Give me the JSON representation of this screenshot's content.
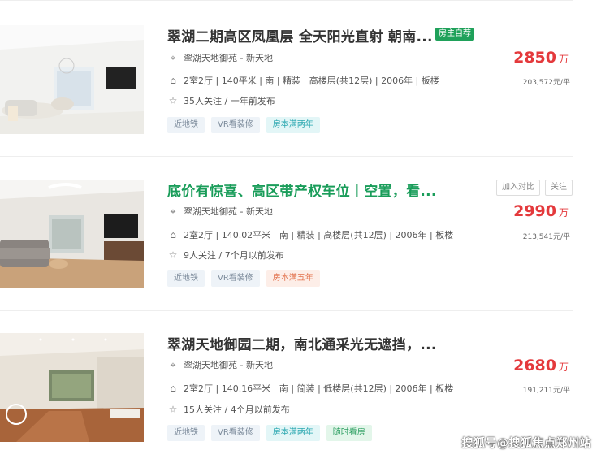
{
  "listings": [
    {
      "title": "翠湖二期高区凤凰层 全天阳光直射 朝南...",
      "badge": "房主自荐",
      "community": "翠湖天地御苑 - 新天地",
      "details": "2室2厅 | 140平米 | 南 | 精装 | 高楼层(共12层) | 2006年 | 板楼",
      "followers": "35人关注 / 一年前发布",
      "tags": [
        "近地铁",
        "VR看装修",
        "房本满两年"
      ],
      "price": "2850",
      "price_unit": "万",
      "unit_price": "203,572元/平"
    },
    {
      "title": "底价有惊喜、高区带产权车位丨空置，看...",
      "compare_label": "加入对比",
      "follow_label": "关注",
      "community": "翠湖天地御苑 - 新天地",
      "details": "2室2厅 | 140.02平米 | 南 | 精装 | 高楼层(共12层) | 2006年 | 板楼",
      "followers": "9人关注 / 7个月以前发布",
      "tags": [
        "近地铁",
        "VR看装修",
        "房本满五年"
      ],
      "price": "2990",
      "price_unit": "万",
      "unit_price": "213,541元/平"
    },
    {
      "title": "翠湖天地御园二期，南北通采光无遮挡，...",
      "community": "翠湖天地御苑 - 新天地",
      "details": "2室2厅 | 140.16平米 | 南 | 简装 | 低楼层(共12层) | 2006年 | 板楼",
      "followers": "15人关注 / 4个月以前发布",
      "tags": [
        "近地铁",
        "VR看装修",
        "房本满两年",
        "随时看房"
      ],
      "price": "2680",
      "price_unit": "万",
      "unit_price": "191,211元/平"
    }
  ],
  "watermark": "搜狐号@搜狐焦点郑州站",
  "colors": {
    "price": "#e4393c",
    "title_green": "#1a9d5a",
    "badge": "#1fa15a"
  },
  "icons": {
    "location": "location-pin-icon",
    "house": "house-icon",
    "star": "star-icon"
  }
}
